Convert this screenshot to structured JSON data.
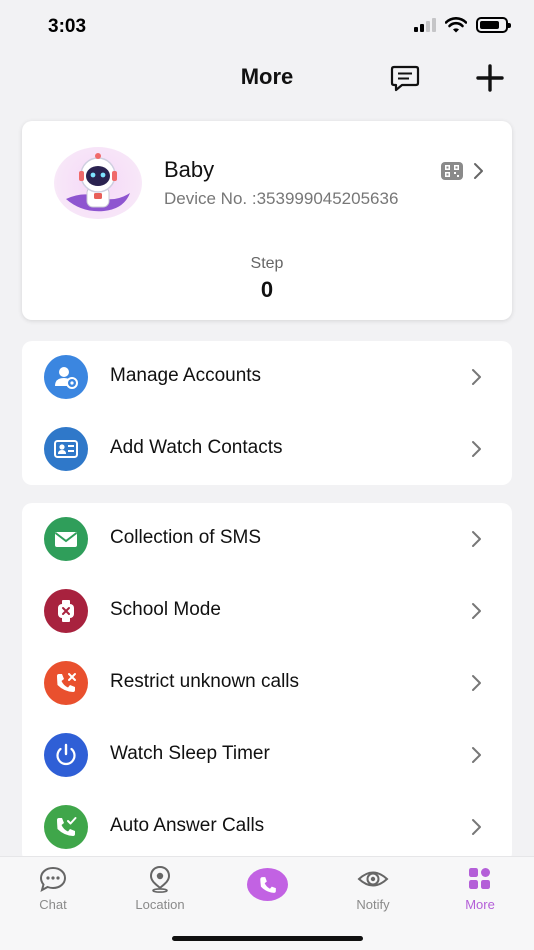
{
  "status_bar": {
    "time": "3:03"
  },
  "header": {
    "title": "More",
    "message_icon": "message-icon",
    "add_icon": "plus-icon"
  },
  "profile": {
    "name": "Baby",
    "device_no": "Device No. :353999045205636",
    "step_label": "Step",
    "step_value": "0"
  },
  "group_1": [
    {
      "label": "Manage Accounts",
      "icon": "manage-accounts-icon",
      "color": "#3b86e0"
    },
    {
      "label": "Add Watch Contacts",
      "icon": "contacts-card-icon",
      "color": "#2f78c9"
    }
  ],
  "group_2": [
    {
      "label": "Collection of SMS",
      "icon": "envelope-icon",
      "color": "#2f9e5a"
    },
    {
      "label": "School Mode",
      "icon": "watch-icon",
      "color": "#a8223e"
    },
    {
      "label": "Restrict unknown calls",
      "icon": "phone-blocked-icon",
      "color": "#e9502e"
    },
    {
      "label": "Watch Sleep Timer",
      "icon": "power-timer-icon",
      "color": "#2f5fd6"
    },
    {
      "label": "Auto Answer Calls",
      "icon": "phone-check-icon",
      "color": "#3fa64a"
    }
  ],
  "tabs": [
    {
      "label": "Chat",
      "icon": "chat-bubble-icon",
      "active": false
    },
    {
      "label": "Location",
      "icon": "location-pin-icon",
      "active": false
    },
    {
      "label": "",
      "icon": "phone-icon",
      "active": false
    },
    {
      "label": "Notify",
      "icon": "eye-icon",
      "active": false
    },
    {
      "label": "More",
      "icon": "grid-icon",
      "active": true
    }
  ],
  "colors": {
    "accent": "#c262e3",
    "active_tab": "#b45fd8",
    "background": "#f2f2f4"
  }
}
